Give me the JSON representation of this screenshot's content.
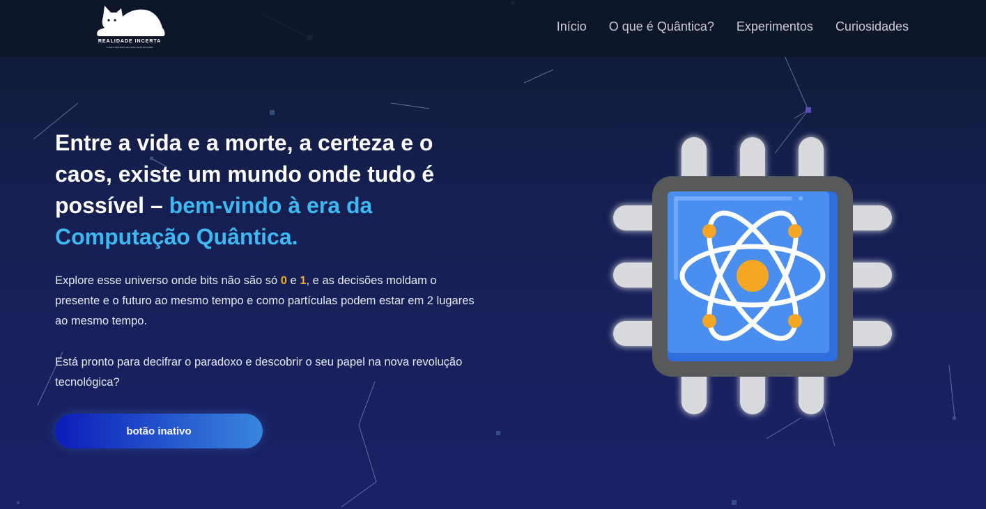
{
  "brand": {
    "name": "REALIDADE INCERTA",
    "tagline": "O GATO NÃO ESTÁ NA CAIXA, ESTÁ NO QUBIT",
    "logo_icon": "cat-icon"
  },
  "nav": {
    "items": [
      "Início",
      "O que é Quântica?",
      "Experimentos",
      "Curiosidades"
    ]
  },
  "hero": {
    "headline_part1": "Entre a vida e a morte, a certeza e o caos, existe um mundo onde tudo é possível – ",
    "headline_highlight": "bem-vindo à era da Computação Quântica.",
    "para1": {
      "before": "Explore esse universo onde bits não são só ",
      "bit0": "0",
      "mid": " e ",
      "bit1": "1",
      "after": ", e as decisões moldam o presente e o futuro ao mesmo tempo e como partículas podem estar em 2 lugares ao mesmo tempo."
    },
    "para2": "Está pronto para decifrar o paradoxo e descobrir o seu papel na nova revolução tecnológica?",
    "button_label": "botão inativo"
  },
  "illustration": {
    "icon": "quantum-chip-atom-icon"
  },
  "colors": {
    "accent": "#3db8f0",
    "bit_highlight": "#f5a623",
    "button_start": "#0b1cb8",
    "button_end": "#3a86de",
    "chip_blue": "#4a8ff0",
    "atom_orange": "#f5a623"
  }
}
